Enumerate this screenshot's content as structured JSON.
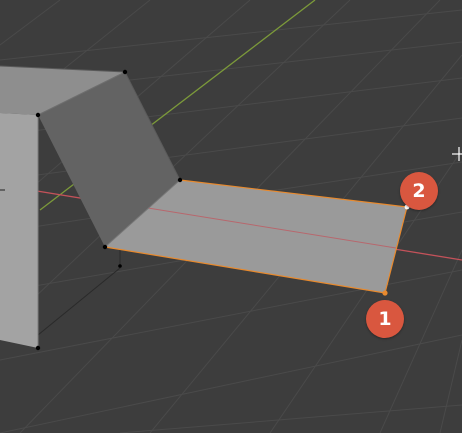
{
  "colors": {
    "background": "#3d3d3d",
    "grid_line": "#4a4a4a",
    "axis_x": "#c4525a",
    "axis_y": "#7c9a3a",
    "mesh_front_face": "#a3a3a3",
    "mesh_top_face": "#8e8e8e",
    "mesh_slope_face": "#636363",
    "mesh_floor_face": "#9a9a9a",
    "selected_edge": "#e88a2e",
    "vertex": "#000000",
    "selected_vertex": "#ffffff",
    "badge": "#d9573f"
  },
  "badges": [
    {
      "label": "1",
      "icon": "step-number-badge"
    },
    {
      "label": "2",
      "icon": "step-number-badge"
    }
  ],
  "cursor": {
    "icon": "crosshair-cursor-icon"
  }
}
